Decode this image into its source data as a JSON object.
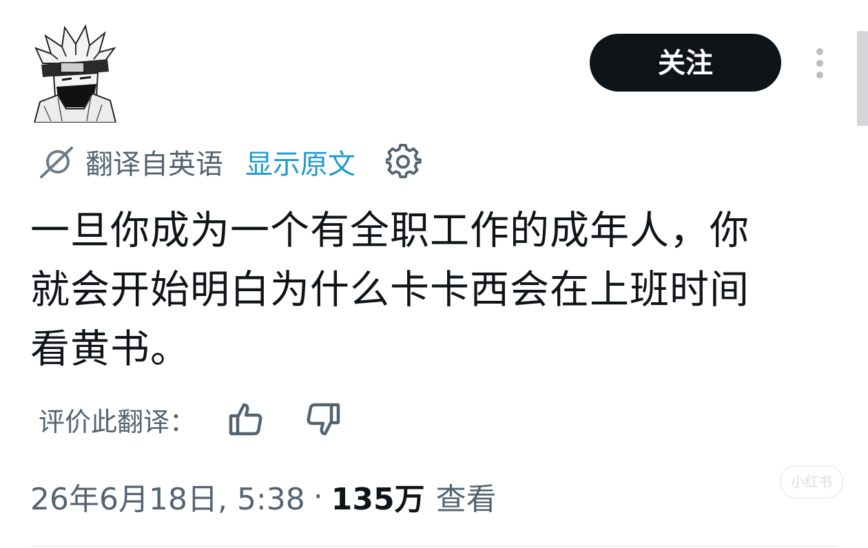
{
  "author": {
    "avatar_icon": "avatar-manga-character"
  },
  "header": {
    "follow_label": "关注",
    "more_icon": "more-vertical-icon"
  },
  "translation": {
    "icon": "translate-icon",
    "translated_from": "翻译自英语",
    "show_original": "显示原文",
    "settings_icon": "gear-icon"
  },
  "tweet": {
    "lines": [
      "一旦你成为一个有全职工作的成年人，你",
      "就会开始明白为什么卡卡西会在上班时间",
      "看黄书。"
    ]
  },
  "rating": {
    "label": "评价此翻译：",
    "thumbs_up_icon": "thumbs-up-icon",
    "thumbs_down_icon": "thumbs-down-icon"
  },
  "meta": {
    "timestamp": "26年6月18日, 5:38",
    "separator": "·",
    "views_count": "135万",
    "views_label": "查看"
  },
  "watermark": {
    "text": "小红书"
  },
  "colors": {
    "primary_text": "#0f1419",
    "secondary_text": "#536471",
    "link": "#1d9bd0",
    "button_bg": "#0f1419"
  }
}
